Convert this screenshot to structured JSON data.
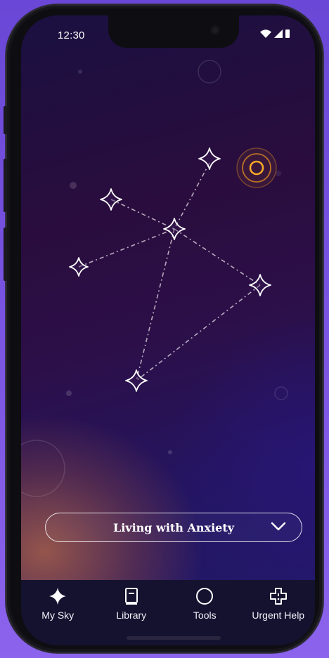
{
  "status_bar": {
    "time": "12:30",
    "icons": [
      "wifi-icon",
      "cellular-icon",
      "battery-icon"
    ]
  },
  "constellation": {
    "stars": [
      "star-icon",
      "star-icon",
      "star-icon",
      "star-icon",
      "star-icon",
      "star-icon"
    ],
    "beacon": "target-ring-icon"
  },
  "topic_selector": {
    "label": "Living with Anxiety",
    "icon": "chevron-down-icon"
  },
  "tabs": [
    {
      "label": "My Sky",
      "icon": "sparkle-icon",
      "active": true
    },
    {
      "label": "Library",
      "icon": "book-icon",
      "active": false
    },
    {
      "label": "Tools",
      "icon": "circle-icon",
      "active": false
    },
    {
      "label": "Urgent Help",
      "icon": "medical-cross-icon",
      "active": false
    }
  ],
  "colors": {
    "accent_ring": "#f29a1e",
    "star_stroke": "#ffffff",
    "tabbar_bg": "#151230"
  }
}
